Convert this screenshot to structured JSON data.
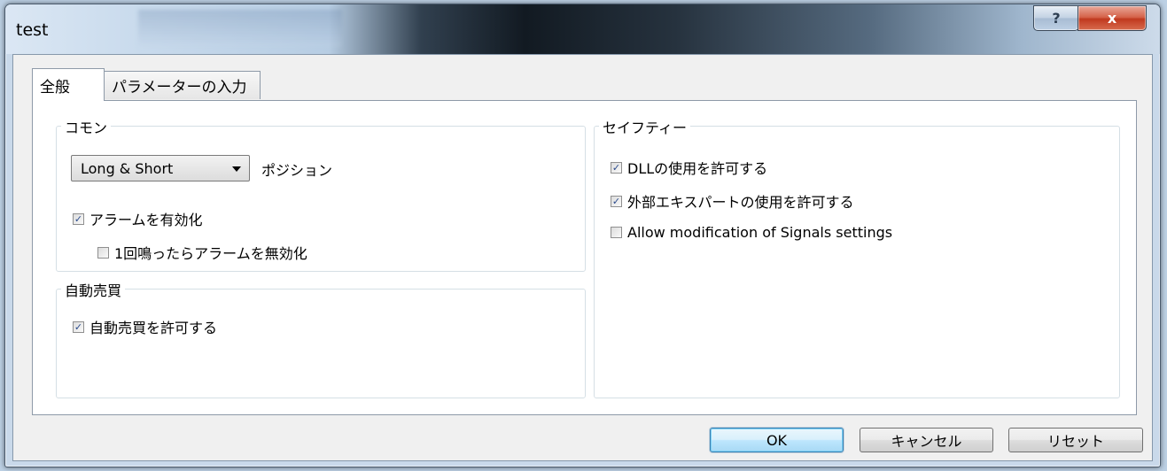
{
  "window": {
    "title": "test",
    "help_label": "?",
    "close_label": "x"
  },
  "tabs": [
    {
      "label": "全般",
      "active": true
    },
    {
      "label": "パラメーターの入力",
      "active": false
    }
  ],
  "common_group": {
    "label": "コモン",
    "position_select": {
      "value": "Long & Short"
    },
    "position_label": "ポジション",
    "enable_alarm": {
      "label": "アラームを有効化",
      "checked": true
    },
    "disable_after_once": {
      "label": "1回鳴ったらアラームを無効化",
      "checked": false
    }
  },
  "auto_trade_group": {
    "label": "自動売買",
    "allow_auto_trade": {
      "label": "自動売買を許可する",
      "checked": true
    }
  },
  "safety_group": {
    "label": "セイフティー",
    "allow_dll": {
      "label": "DLLの使用を許可する",
      "checked": true
    },
    "allow_external_experts": {
      "label": "外部エキスパートの使用を許可する",
      "checked": true
    },
    "allow_signals_mod": {
      "label": "Allow modification of Signals settings",
      "checked": false
    }
  },
  "buttons": {
    "ok": "OK",
    "cancel": "キャンセル",
    "reset": "リセット"
  }
}
